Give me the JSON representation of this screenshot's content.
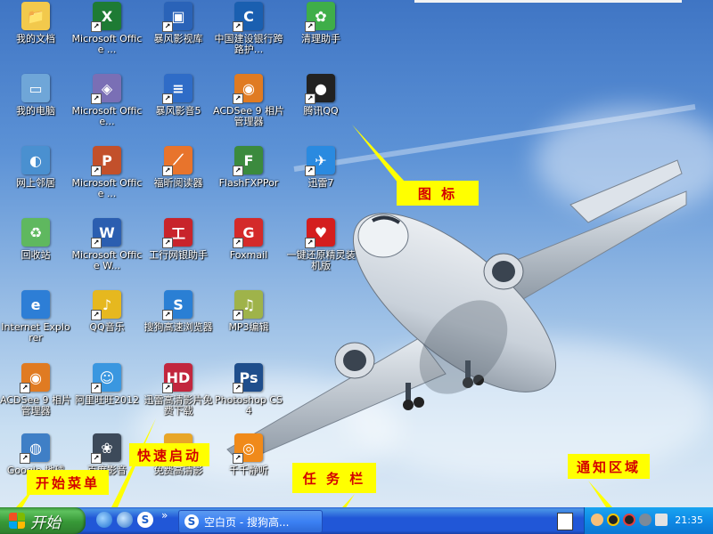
{
  "desktop_icons": [
    {
      "label": "我的文档",
      "icon": "folder-documents-icon",
      "color": "#f2c94c",
      "col": 0,
      "row": 0,
      "glyph": "📁",
      "shortcut": false
    },
    {
      "label": "Microsoft Office ...",
      "icon": "excel-icon",
      "color": "#1e7b34",
      "col": 1,
      "row": 0,
      "glyph": "X",
      "shortcut": true
    },
    {
      "label": "暴风影视库",
      "icon": "baofeng-library-icon",
      "color": "#2a63b8",
      "col": 2,
      "row": 0,
      "glyph": "▣",
      "shortcut": true
    },
    {
      "label": "中国建设银行跨路护...",
      "icon": "ccb-icon",
      "color": "#1a5fb0",
      "col": 3,
      "row": 0,
      "glyph": "C",
      "shortcut": true
    },
    {
      "label": "清理助手",
      "icon": "cleanup-helper-icon",
      "color": "#3fae49",
      "col": 4,
      "row": 0,
      "glyph": "✿",
      "shortcut": true
    },
    {
      "label": "我的电脑",
      "icon": "my-computer-icon",
      "color": "#6fa6d8",
      "col": 0,
      "row": 1,
      "glyph": "▭",
      "shortcut": false
    },
    {
      "label": "Microsoft Office...",
      "icon": "office-tools-icon",
      "color": "#7a6fb5",
      "col": 1,
      "row": 1,
      "glyph": "◈",
      "shortcut": true
    },
    {
      "label": "暴风影音5",
      "icon": "baofeng-player-icon",
      "color": "#2f6cc7",
      "col": 2,
      "row": 1,
      "glyph": "≡",
      "shortcut": true
    },
    {
      "label": "ACDSee 9 相片管理器",
      "icon": "acdsee-icon",
      "color": "#e07b22",
      "col": 3,
      "row": 1,
      "glyph": "◉",
      "shortcut": true
    },
    {
      "label": "腾讯QQ",
      "icon": "qq-penguin-icon",
      "color": "#222222",
      "col": 4,
      "row": 1,
      "glyph": "●",
      "shortcut": true
    },
    {
      "label": "网上邻居",
      "icon": "network-places-icon",
      "color": "#4a90d0",
      "col": 0,
      "row": 2,
      "glyph": "◐",
      "shortcut": false
    },
    {
      "label": "Microsoft Office ...",
      "icon": "powerpoint-icon",
      "color": "#c2502b",
      "col": 1,
      "row": 2,
      "glyph": "P",
      "shortcut": true
    },
    {
      "label": "福昕阅读器",
      "icon": "foxit-reader-icon",
      "color": "#e8742c",
      "col": 2,
      "row": 2,
      "glyph": "⟋",
      "shortcut": true
    },
    {
      "label": "FlashFXPPor",
      "icon": "flashfxp-icon",
      "color": "#3b8a3e",
      "col": 3,
      "row": 2,
      "glyph": "F",
      "shortcut": true
    },
    {
      "label": "迅雷7",
      "icon": "thunder-icon",
      "color": "#2a8ae0",
      "col": 4,
      "row": 2,
      "glyph": "✈",
      "shortcut": true
    },
    {
      "label": "回收站",
      "icon": "recycle-bin-icon",
      "color": "#5fb85f",
      "col": 0,
      "row": 3,
      "glyph": "♻",
      "shortcut": false
    },
    {
      "label": "Microsoft Office W...",
      "icon": "word-icon",
      "color": "#2b5eb0",
      "col": 1,
      "row": 3,
      "glyph": "W",
      "shortcut": true
    },
    {
      "label": "工行网银助手",
      "icon": "icbc-helper-icon",
      "color": "#c8242b",
      "col": 2,
      "row": 3,
      "glyph": "工",
      "shortcut": true
    },
    {
      "label": "Foxmail",
      "icon": "foxmail-icon",
      "color": "#d42a2a",
      "col": 3,
      "row": 3,
      "glyph": "G",
      "shortcut": true
    },
    {
      "label": "一键还原精灵装机版",
      "icon": "one-key-restore-icon",
      "color": "#d41e1e",
      "col": 4,
      "row": 3,
      "glyph": "♥",
      "shortcut": true
    },
    {
      "label": "Internet Explorer",
      "icon": "internet-explorer-icon",
      "color": "#2d7ed6",
      "col": 0,
      "row": 4,
      "glyph": "e",
      "shortcut": false
    },
    {
      "label": "QQ音乐",
      "icon": "qq-music-icon",
      "color": "#e6b81f",
      "col": 1,
      "row": 4,
      "glyph": "♪",
      "shortcut": true
    },
    {
      "label": "搜狗高速浏览器",
      "icon": "sogou-browser-icon",
      "color": "#2a7fd4",
      "col": 2,
      "row": 4,
      "glyph": "S",
      "shortcut": true
    },
    {
      "label": "MP3编辑",
      "icon": "mp3-editor-icon",
      "color": "#9fb34a",
      "col": 3,
      "row": 4,
      "glyph": "♫",
      "shortcut": true
    },
    {
      "label": "ACDSee 9 相片管理器",
      "icon": "acdsee-icon",
      "color": "#e07b22",
      "col": 0,
      "row": 5,
      "glyph": "◉",
      "shortcut": true
    },
    {
      "label": "阿里旺旺2012",
      "icon": "aliwangwang-icon",
      "color": "#3a97e0",
      "col": 1,
      "row": 5,
      "glyph": "☺",
      "shortcut": true
    },
    {
      "label": "迅雷高清影片免费下载",
      "icon": "xunlei-hd-icon",
      "color": "#c2263e",
      "col": 2,
      "row": 5,
      "glyph": "HD",
      "shortcut": true
    },
    {
      "label": "Photoshop CS4",
      "icon": "photoshop-icon",
      "color": "#1f4e8c",
      "col": 3,
      "row": 5,
      "glyph": "Ps",
      "shortcut": true
    },
    {
      "label": "Google 地球",
      "icon": "google-earth-icon",
      "color": "#3f7fc6",
      "col": 0,
      "row": 6,
      "glyph": "◍",
      "shortcut": true
    },
    {
      "label": "百度影音",
      "icon": "baidu-player-icon",
      "color": "#3d4a5a",
      "col": 1,
      "row": 6,
      "glyph": "❀",
      "shortcut": true
    },
    {
      "label": "免费高清影",
      "icon": "free-hd-movie-icon",
      "color": "#e8a628",
      "col": 2,
      "row": 6,
      "glyph": "▶",
      "shortcut": true
    },
    {
      "label": "千千静听",
      "icon": "ttplayer-icon",
      "color": "#f08a1a",
      "col": 3,
      "row": 6,
      "glyph": "◎",
      "shortcut": true
    }
  ],
  "annotations": {
    "icons": "图 标",
    "quick_launch": "快速启动",
    "start_menu": "开始菜单",
    "taskbar": "任 务 栏",
    "notification_area": "通知区域"
  },
  "taskbar": {
    "start_label": "开始",
    "chevron": "»",
    "task_button_label": "空白页 - 搜狗高...",
    "task_button_icon": "S",
    "clock": "21:35"
  },
  "colors": {
    "annotation_bg": "#ffff00",
    "annotation_text": "#d40000",
    "taskbar_blue": "#2157d7",
    "start_green": "#379837",
    "tray_blue": "#0e8ae6"
  }
}
